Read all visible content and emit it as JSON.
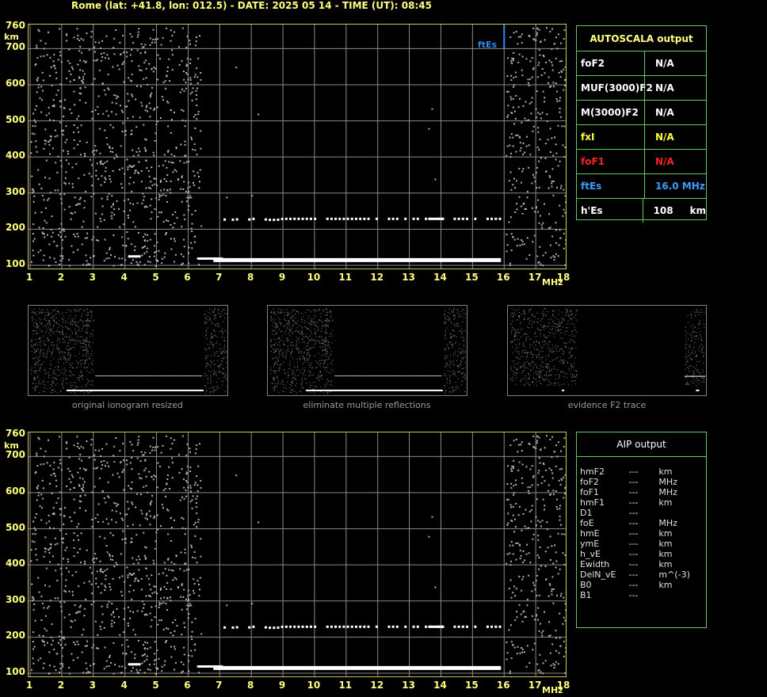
{
  "header": {
    "title": "Rome (lat: +41.8, lon: 012.5) - DATE: 2025 05 14 - TIME (UT): 08:45"
  },
  "axes": {
    "y_unit": "km",
    "x_unit": "MHz",
    "y_ticks": [
      "760",
      "700",
      "600",
      "500",
      "400",
      "300",
      "200",
      "100"
    ],
    "x_ticks": [
      "1",
      "2",
      "3",
      "4",
      "5",
      "6",
      "7",
      "8",
      "9",
      "10",
      "11",
      "12",
      "13",
      "14",
      "15",
      "16",
      "17",
      "18"
    ]
  },
  "top_plot": {
    "es_label": "ftEs"
  },
  "thumbnails": [
    {
      "caption": "original ionogram resized"
    },
    {
      "caption": "eliminate multiple reflections"
    },
    {
      "caption": "evidence F2 trace"
    }
  ],
  "autoscala": {
    "title": "AUTOSCALA output",
    "rows": [
      {
        "key": "foF2",
        "value": "N/A",
        "color": "#ffffff"
      },
      {
        "key": "MUF(3000)F2",
        "value": "N/A",
        "color": "#ffffff"
      },
      {
        "key": "M(3000)F2",
        "value": "N/A",
        "color": "#ffffff"
      },
      {
        "key": "fxI",
        "value": "N/A",
        "color": "#ffff40"
      },
      {
        "key": "foF1",
        "value": "N/A",
        "color": "#ff2020"
      },
      {
        "key": "ftEs",
        "value": "16.0 MHz",
        "color": "#3c9cff"
      },
      {
        "key": "h'Es",
        "value": "108     km",
        "color": "#ffffff"
      }
    ]
  },
  "aip": {
    "title": "AIP output",
    "rows": [
      {
        "key": "hmF2",
        "dash": "---",
        "unit": "km"
      },
      {
        "key": "foF2",
        "dash": "---",
        "unit": "MHz"
      },
      {
        "key": "foF1",
        "dash": "---",
        "unit": "MHz"
      },
      {
        "key": "hmF1",
        "dash": "---",
        "unit": "km"
      },
      {
        "key": "D1",
        "dash": "---",
        "unit": ""
      },
      {
        "key": "foE",
        "dash": "---",
        "unit": "MHz"
      },
      {
        "key": "hmE",
        "dash": "---",
        "unit": "km"
      },
      {
        "key": "ymE",
        "dash": "---",
        "unit": "km"
      },
      {
        "key": "h_vE",
        "dash": "---",
        "unit": "km"
      },
      {
        "key": "Ewidth",
        "dash": "---",
        "unit": "km"
      },
      {
        "key": "DelN_vE",
        "dash": "---",
        "unit": "m^(-3)"
      },
      {
        "key": "B0",
        "dash": "---",
        "unit": "km"
      },
      {
        "key": "B1",
        "dash": "---",
        "unit": ""
      }
    ]
  },
  "colors": {
    "grid": "#8a8a8a",
    "plot_border": "#c8c850",
    "es_marker": "#2a8cf0",
    "trace": "#ffffff",
    "noise": "#b0b0b0"
  }
}
